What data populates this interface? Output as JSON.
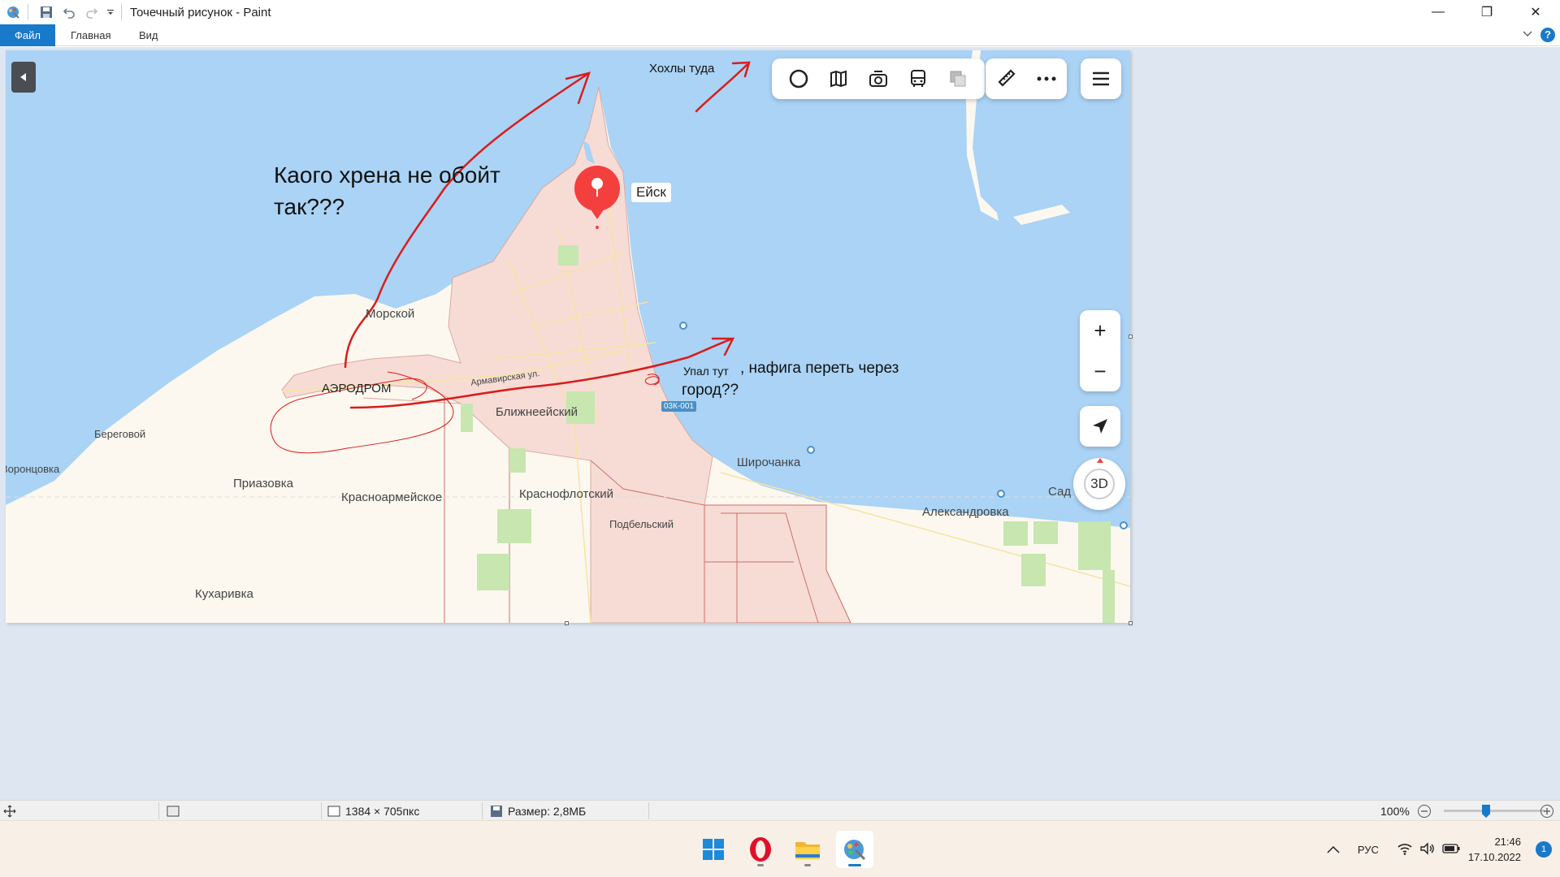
{
  "window": {
    "title": "Точечный рисунок - Paint",
    "controls": {
      "minimize": "—",
      "restore": "❐",
      "close": "✕"
    }
  },
  "ribbon": {
    "tabs": [
      {
        "label": "Файл",
        "active": true
      },
      {
        "label": "Главная"
      },
      {
        "label": "Вид"
      }
    ],
    "help": "?"
  },
  "map": {
    "city_label": "Ейск",
    "road_badge": "03К-001",
    "zoom_in": "+",
    "zoom_out": "−",
    "btn_3d": "3D",
    "place_labels": {
      "morskoy": "Морской",
      "aerodrom": "АЭРОДРОМ",
      "armavirskaya": "Армавирская ул.",
      "blizhneeysky": "Ближнеейский",
      "beregovoy": "Береговой",
      "vorontsovka": "Воронцовка",
      "priazovka": "Приазовка",
      "krasnoarmeyskoe": "Красноармейское",
      "krasnoflotsky": "Краснофлотский",
      "podbelsky": "Подбельский",
      "shirochanka": "Широчанка",
      "aleksandrovka": "Александровка",
      "sad": "Сад",
      "kukharivka": "Кухаривка"
    }
  },
  "annotations": {
    "khokhly": "Хохлы туда",
    "question_line1": "Каого хрена не обойт",
    "question_line2": "так???",
    "fell_here": "Упал тут",
    "city_question_line1": ", нафига переть через",
    "city_question_line2": "город??"
  },
  "statusbar": {
    "dimensions": "1384 × 705пкс",
    "size": "Размер: 2,8МБ",
    "zoom": "100%",
    "zoom_percent": 100
  },
  "taskbar": {
    "apps": [
      {
        "name": "start",
        "icon": "windows-logo-icon"
      },
      {
        "name": "opera",
        "icon": "opera-icon"
      },
      {
        "name": "explorer",
        "icon": "folder-icon"
      },
      {
        "name": "paint",
        "icon": "paint-icon",
        "active": true
      }
    ],
    "language": "РУС",
    "time": "21:46",
    "date": "17.10.2022",
    "notifications": "1"
  },
  "colors": {
    "accent": "#1979ca",
    "sea": "#aad3f5",
    "land": "#fcf8ef",
    "city": "#f7dcd6",
    "annotation_red": "#d91c1c",
    "pin": "#f43f3f"
  }
}
